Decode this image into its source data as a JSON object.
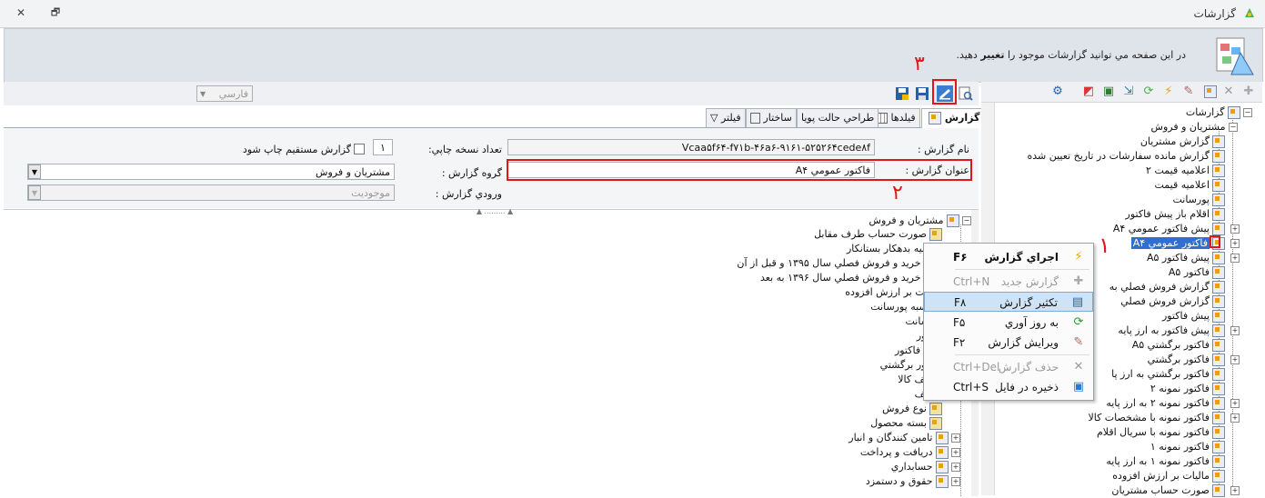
{
  "window": {
    "title": "گزارشات",
    "close_glyph": "✕",
    "restore_glyph": "🗗"
  },
  "header": {
    "message_pre": "در اين صفحه مي توانيد گزارشات موجود را ",
    "message_bold": "تغيير",
    "message_post": " دهيد."
  },
  "annotations": {
    "n1": "۱",
    "n2": "۲",
    "n3": "۳"
  },
  "tree_right": {
    "root": "گزارشات",
    "group": "مشتريان و فروش",
    "items": [
      "گزارش مشتريان",
      "گزارش مانده سفارشات در تاريخ تعيين شده",
      "اعلاميه قيمت ۲",
      "اعلاميه قيمت",
      "پورسانت",
      "اقلام باز پيش فاکتور",
      "پيش فاکتور عمومي A۴",
      "فاكتور عمومي A۴",
      "پيش فاکتور A۵",
      "فاکتور A۵",
      "گزارش فروش فصلي به",
      "گزارش فروش فصلي",
      "پيش فاکتور",
      "پيش فاکتور به ارز پايه",
      "فاکتور برگشتي A۵",
      "فاکتور برگشتي",
      "فاکتور برگشتي به ارز پا",
      "فاکتور نمونه ۲",
      "فاکتور نمونه ۲ به ارز پايه",
      "فاکتور نمونه با مشخصات کالا",
      "فاکتور نمونه با سريال اقلام",
      "فاکتور نمونه ۱",
      "فاکتور نمونه ۱ به ارز پايه",
      "ماليات بر ارزش افزوده",
      "صورت حساب مشتريان"
    ]
  },
  "toolbar_center": {
    "language_value": "فارسي"
  },
  "tabs": [
    "گزارش",
    "فيلدها",
    "طراحي حالت پويا",
    "ساختار",
    "فيلتر"
  ],
  "form": {
    "report_name_label": "نام گزارش :",
    "report_name_value": "Vcaa۵f۶۴-f۷۱b-۴۶a۶-۹۱۶۱-۵۲۵۲۶۴cede۸f",
    "report_title_label": "عنوان گزارش :",
    "report_title_value": "فاكتور عمومي A۴",
    "copies_label": "تعداد نسخه چاپي:",
    "copies_value": "۱",
    "direct_print_label": "گزارش مستقيم چاپ شود",
    "group_label": "گروه گزارش :",
    "group_value": "مشتريان و فروش",
    "input_label": "ورودي گزارش :",
    "input_value": "موجوديت"
  },
  "tree_center": {
    "root": "مشتريان و فروش",
    "items": [
      "صورت حساب طرف مقابل",
      "اعلاميه بدهکار بستانکار",
      "فايل خريد و فروش فصلي سال ۱۳۹۵ و قبل از آن",
      "فايل خريد و فروش فصلي سال ۱۳۹۶ به بعد",
      "ماليات بر ارزش افزوده",
      "محاسبه پورسانت",
      "پورسانت",
      "فاکتور",
      "پيش فاکتور",
      "فاکتور برگشتي",
      "تخفيف کالا",
      "تخفيف",
      "نوع فروش",
      "بسته محصول"
    ],
    "groups": [
      "تامين کنندگان و انبار",
      "دريافت و پرداخت",
      "حسابداري",
      "حقوق و دستمزد"
    ]
  },
  "context_menu": {
    "items": [
      {
        "label": "اجراي گزارش",
        "shortcut": "F۶",
        "icon": "lightning-icon"
      },
      {
        "label": "گزارش جديد",
        "shortcut": "Ctrl+N",
        "icon": "plus-icon"
      },
      {
        "label": "تكثير گزارش",
        "shortcut": "F۸",
        "icon": "copy-report-icon"
      },
      {
        "label": "به روز آوري",
        "shortcut": "F۵",
        "icon": "refresh-icon"
      },
      {
        "label": "ويرايش گزارش",
        "shortcut": "F۲",
        "icon": "edit-icon"
      },
      {
        "label": "حذف گزارش",
        "shortcut": "Ctrl+Del",
        "icon": "delete-icon"
      },
      {
        "label": "ذخيره در فايل",
        "shortcut": "Ctrl+S",
        "icon": "save-file-icon"
      }
    ]
  },
  "colors": {
    "highlight_red": "#e0161b",
    "selection_blue": "#cfe3f7",
    "header_bg": "#dfe3ea"
  }
}
